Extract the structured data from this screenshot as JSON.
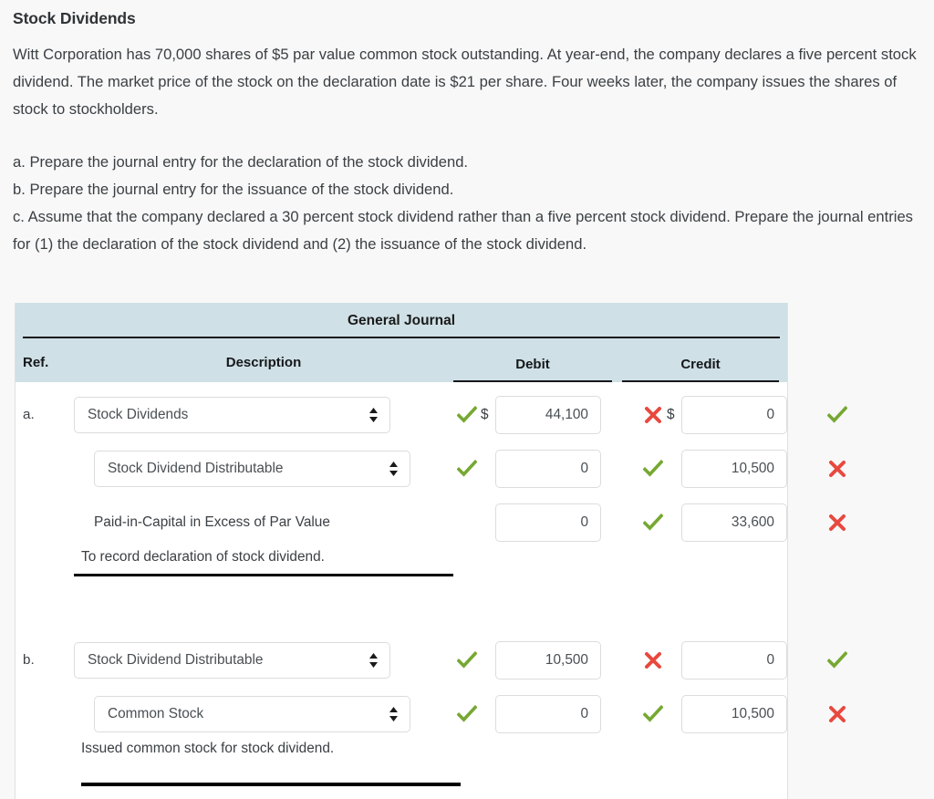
{
  "problem": {
    "title": "Stock Dividends",
    "paragraph": "Witt Corporation has 70,000 shares of $5 par value common stock outstanding. At year-end, the company declares a five percent stock dividend. The market price of the stock on the declaration date is $21 per share. Four weeks later, the company issues the shares of stock to stockholders.",
    "item_a": "a. Prepare the journal entry for the declaration of the stock dividend.",
    "item_b": "b. Prepare the journal entry for the issuance of the stock dividend.",
    "item_c": "c. Assume that the company declared a 30 percent stock dividend rather than a five percent stock dividend. Prepare the journal entries for (1) the declaration of the stock dividend and (2) the issuance of the stock dividend."
  },
  "journal": {
    "title": "General Journal",
    "columns": {
      "ref": "Ref.",
      "description": "Description",
      "debit": "Debit",
      "credit": "Credit"
    },
    "currency_symbol": "$",
    "entries": [
      {
        "ref": "a.",
        "lines": [
          {
            "kind": "select",
            "indent": 0,
            "description": "Stock Dividends",
            "desc_status": "correct",
            "show_dollar": true,
            "debit": "44,100",
            "debit_status": "incorrect",
            "credit": "0",
            "credit_status": "correct"
          },
          {
            "kind": "select",
            "indent": 1,
            "description": "Stock Dividend Distributable",
            "desc_status": "correct",
            "show_dollar": false,
            "debit": "0",
            "debit_status": "correct",
            "credit": "10,500",
            "credit_status": "incorrect"
          },
          {
            "kind": "text",
            "indent": 1,
            "description": "Paid-in-Capital in Excess of Par Value",
            "desc_status": "none",
            "show_dollar": false,
            "debit": "0",
            "debit_status": "correct",
            "credit": "33,600",
            "credit_status": "incorrect"
          }
        ],
        "memo": "To record declaration of stock dividend."
      },
      {
        "ref": "b.",
        "lines": [
          {
            "kind": "select",
            "indent": 0,
            "description": "Stock Dividend Distributable",
            "desc_status": "correct",
            "show_dollar": false,
            "debit": "10,500",
            "debit_status": "incorrect",
            "credit": "0",
            "credit_status": "correct"
          },
          {
            "kind": "select",
            "indent": 1,
            "description": "Common Stock",
            "desc_status": "correct",
            "show_dollar": false,
            "debit": "0",
            "debit_status": "correct",
            "credit": "10,500",
            "credit_status": "incorrect"
          }
        ],
        "memo": "Issued common stock for stock dividend."
      }
    ]
  },
  "colors": {
    "page_background": "#f8f8f8",
    "header_background": "#cfe0e6",
    "correct_mark": "#76a832",
    "incorrect_mark": "#e8493f",
    "text": "#3b4044",
    "rule": "#15181b"
  },
  "icons": {
    "correct": "check-icon",
    "incorrect": "cross-icon",
    "select_arrow": "select-updown-arrow-icon"
  }
}
